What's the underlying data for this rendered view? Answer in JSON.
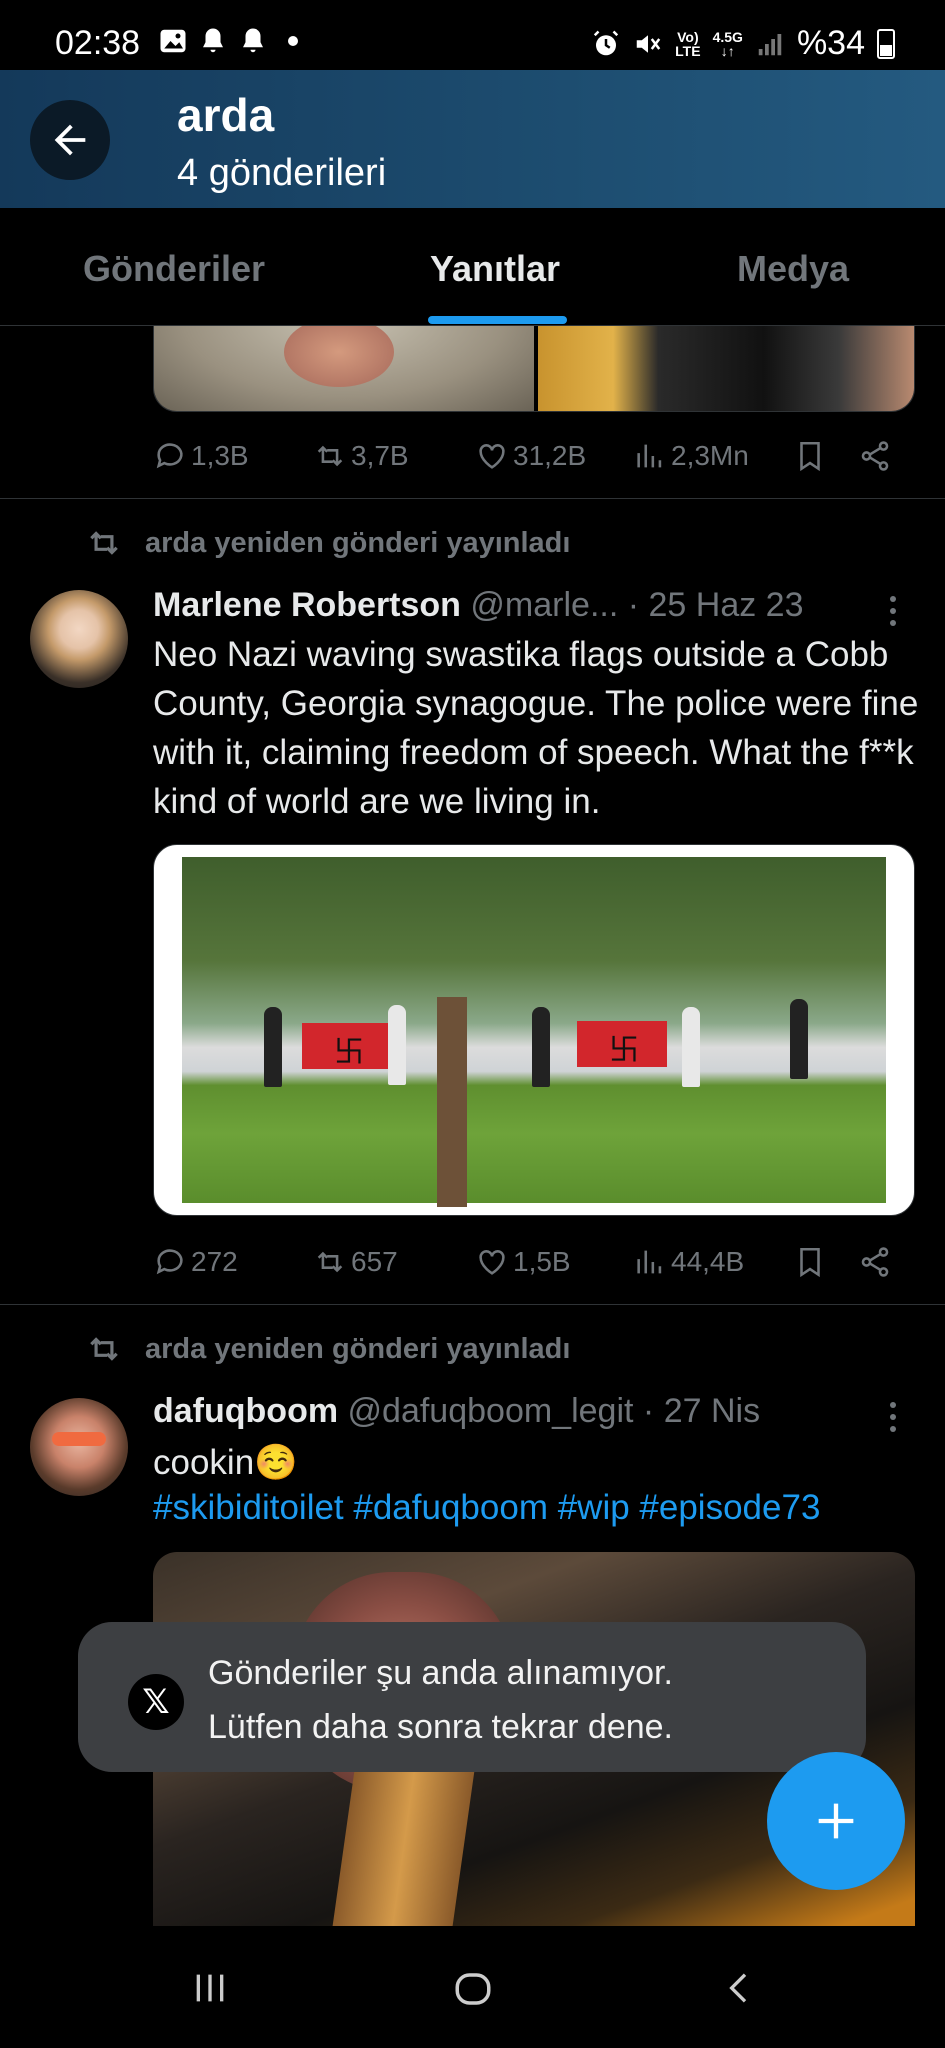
{
  "status_bar": {
    "time": "02:38",
    "network_top": "Vo)",
    "network_bottom": "LTE",
    "network_gen": "4.5G",
    "battery": "%34"
  },
  "header": {
    "name": "arda",
    "post_count": "4 gönderileri"
  },
  "tabs": [
    {
      "label": "Gönderiler",
      "active": false
    },
    {
      "label": "Yanıtlar",
      "active": true
    },
    {
      "label": "Medya",
      "active": false
    }
  ],
  "first_post_actions": {
    "replies": "1,3B",
    "reposts": "3,7B",
    "likes": "31,2B",
    "views": "2,3Mn"
  },
  "posts": [
    {
      "repost_label": "arda yeniden gönderi yayınladı",
      "display_name": "Marlene Robertson",
      "handle": "@marle...",
      "date": "· 25 Haz 23",
      "text": "Neo Nazi waving swastika flags outside a Cobb County, Georgia synagogue.  The police were fine with it, claiming freedom of speech. What the f**k kind of world are we living in.",
      "actions": {
        "replies": "272",
        "reposts": "657",
        "likes": "1,5B",
        "views": "44,4B"
      }
    },
    {
      "repost_label": "arda yeniden gönderi yayınladı",
      "display_name": "dafuqboom",
      "handle": "@dafuqboom_legit",
      "date": "· 27 Nis",
      "text": "cookin☺️",
      "hashtags": "#skibiditoilet #dafuqboom #wip #episode73"
    }
  ],
  "toast": {
    "line1": "Gönderiler şu anda alınamıyor.",
    "line2": "Lütfen daha sonra tekrar dene."
  },
  "icons": {
    "back": "arrow-left-icon",
    "reply": "speech-bubble-icon",
    "repost": "repost-icon",
    "like": "heart-icon",
    "views": "bar-chart-icon",
    "bookmark": "bookmark-icon",
    "share": "share-icon",
    "compose": "plus-icon"
  },
  "colors": {
    "accent": "#1d9bf0",
    "muted": "#71767b",
    "header_bg": "#1d4d70",
    "toast_bg": "#3d3f42"
  }
}
